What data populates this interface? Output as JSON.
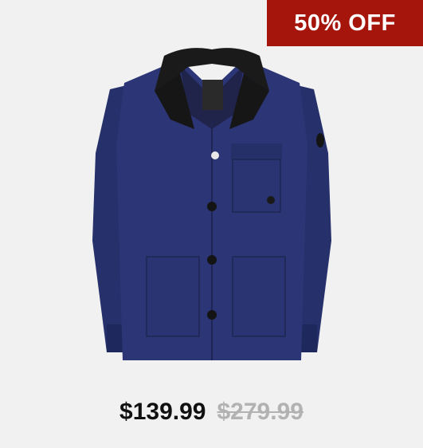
{
  "product": {
    "badge": "50% OFF",
    "image_icon": "navy-jacket",
    "price_current": "$139.99",
    "price_original": "$279.99"
  },
  "colors": {
    "badge_bg": "#a6150c",
    "jacket": "#2b3474",
    "collar": "#1b1b1b",
    "background": "#f1f1f1"
  }
}
